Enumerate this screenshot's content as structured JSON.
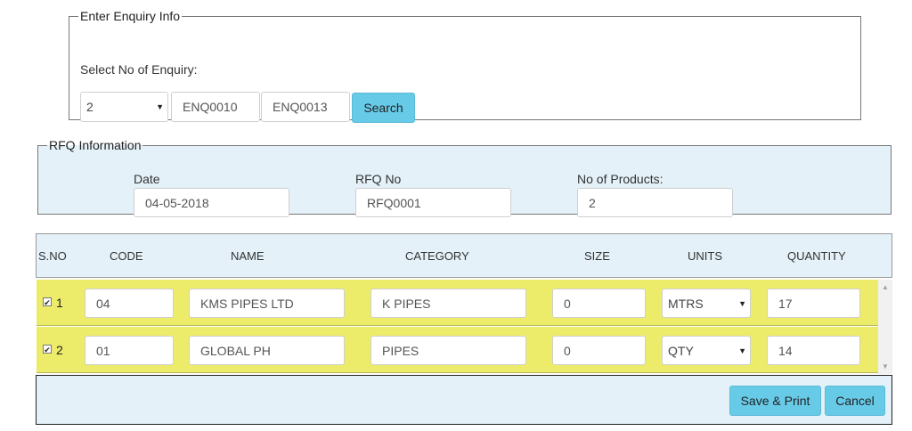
{
  "enquiry": {
    "legend": "Enter Enquiry Info",
    "label": "Select No of Enquiry:",
    "count": "2",
    "from": "ENQ0010",
    "to": "ENQ0013",
    "search_label": "Search"
  },
  "rfq": {
    "legend": "RFQ Information",
    "date_label": "Date",
    "date_value": "04-05-2018",
    "rfq_no_label": "RFQ No",
    "rfq_no_value": "RFQ0001",
    "products_label": "No of Products:",
    "products_value": "2"
  },
  "table": {
    "headers": [
      "S.NO",
      "CODE",
      "NAME",
      "CATEGORY",
      "SIZE",
      "UNITS",
      "QUANTITY"
    ],
    "rows": [
      {
        "sno": "1",
        "checked": true,
        "code": "04",
        "name": "KMS PIPES LTD",
        "category": "K PIPES",
        "size": "0",
        "units": "MTRS",
        "quantity": "17"
      },
      {
        "sno": "2",
        "checked": true,
        "code": "01",
        "name": "GLOBAL PH",
        "category": "PIPES",
        "size": "0",
        "units": "QTY",
        "quantity": "14"
      }
    ]
  },
  "footer": {
    "save_label": "Save & Print",
    "cancel_label": "Cancel"
  },
  "colors": {
    "accent_button": "#67cbe8",
    "panel_bg": "#e4f1f8",
    "row_bg": "#ecec6a"
  }
}
